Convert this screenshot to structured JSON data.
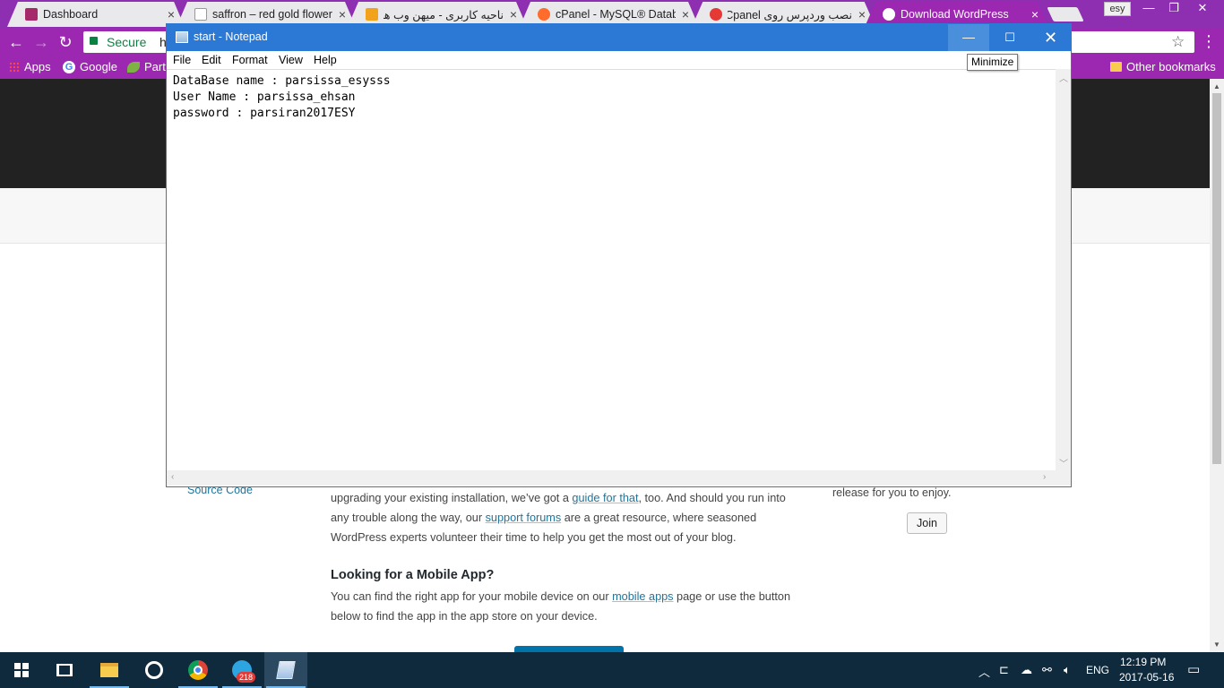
{
  "browser": {
    "tabs": [
      {
        "title": "Dashboard",
        "icon": "yoast-icon"
      },
      {
        "title": "saffron – red gold flower",
        "icon": "page-icon"
      },
      {
        "title": "ناحیه کاربری - میهن وب ها",
        "icon": "mihanweb-icon"
      },
      {
        "title": "cPanel - MySQL® Datab",
        "icon": "cpanel-icon"
      },
      {
        "title": "نصب وردپرس روی Cpanel",
        "icon": "vimeo-icon"
      },
      {
        "title": "Download WordPress",
        "icon": "wordpress-icon"
      }
    ],
    "close_glyph": "×",
    "profile_label": "esy",
    "secure_label": "Secure",
    "url_fragment": "h",
    "bookmarks": {
      "apps": "Apps",
      "google": "Google",
      "parts": "Part",
      "other": "Other bookmarks"
    }
  },
  "wordpress_page": {
    "source_code": "Source Code",
    "paragraph1": [
      {
        "pre": "upgrading your existing installation, we’ve got a ",
        "link": "guide for that",
        "post": ", too. And should you run into"
      },
      {
        "pre": "any trouble along the way, our ",
        "link": "support forums",
        "post": " are a great resource, where seasoned"
      },
      {
        "pre": "WordPress experts volunteer their time to help you get the most out of your blog.",
        "link": "",
        "post": ""
      }
    ],
    "heading": "Looking for a Mobile App?",
    "paragraph2": [
      {
        "pre": "You can find the right app for your mobile device on our ",
        "link": "mobile apps",
        "post": " page or use the button"
      },
      {
        "pre": "below to find the app in the app store on your device.",
        "link": "",
        "post": ""
      }
    ],
    "release_text": "release for you to enjoy.",
    "join_button": "Join"
  },
  "notepad": {
    "title": "start - Notepad",
    "menu": [
      "File",
      "Edit",
      "Format",
      "View",
      "Help"
    ],
    "content_lines": [
      "DataBase name : parsissa_esysss",
      "User Name : parsissa_ehsan",
      "password : parsiran2017ESY"
    ],
    "tooltip": "Minimize",
    "minimize_glyph": "—",
    "maximize_glyph": "☐",
    "close_glyph": "✕"
  },
  "taskbar": {
    "telegram_badge": "218",
    "language": "ENG",
    "time": "12:19 PM",
    "date": "2017-05-16"
  },
  "colors": {
    "chrome_theme": "#9c27b0",
    "notepad_titlebar": "#2b79d4",
    "taskbar": "#0f2a3d",
    "link": "#21759b"
  }
}
